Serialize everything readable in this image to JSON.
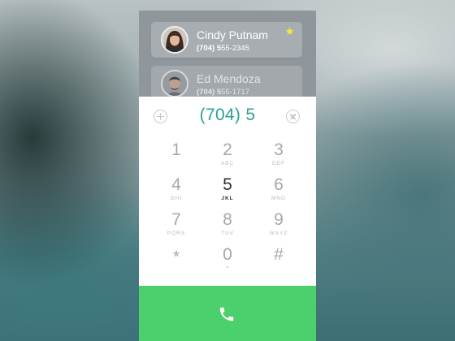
{
  "contacts": [
    {
      "name": "Cindy Putnam",
      "number_match": "(704) 5",
      "number_rest": "55-2345",
      "favorite": true
    },
    {
      "name": "Ed Mendoza",
      "number_match": "(704) 5",
      "number_rest": "55-1717",
      "favorite": false
    }
  ],
  "dialer": {
    "display": "(704) 5",
    "keys": [
      {
        "digit": "1",
        "letters": ""
      },
      {
        "digit": "2",
        "letters": "ABC"
      },
      {
        "digit": "3",
        "letters": "DEF"
      },
      {
        "digit": "4",
        "letters": "GHI"
      },
      {
        "digit": "5",
        "letters": "JKL"
      },
      {
        "digit": "6",
        "letters": "MNO"
      },
      {
        "digit": "7",
        "letters": "PQRS"
      },
      {
        "digit": "8",
        "letters": "TUV"
      },
      {
        "digit": "9",
        "letters": "WXYZ"
      },
      {
        "digit": "*",
        "letters": ""
      },
      {
        "digit": "0",
        "letters": ""
      },
      {
        "digit": "#",
        "letters": ""
      }
    ],
    "active_key": "5"
  },
  "icons": {
    "add_contact": "plus-circle-icon",
    "delete": "x-circle-icon",
    "favorite": "star-icon",
    "call": "phone-handset-icon"
  },
  "colors": {
    "accent": "#2aa197",
    "call_button": "#4bd06b",
    "favorite_star": "#f5e63b",
    "contacts_panel": "#90979c"
  }
}
